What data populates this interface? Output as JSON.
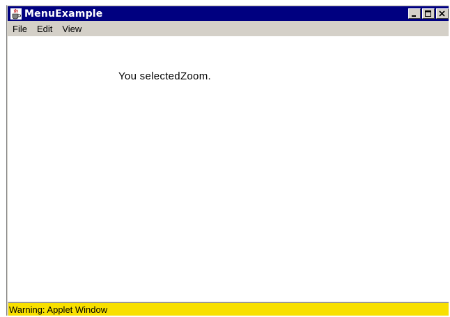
{
  "window": {
    "title": "MenuExample",
    "icon": "java-cup-icon"
  },
  "title_buttons": {
    "minimize_icon": "minimize-icon",
    "maximize_icon": "maximize-icon",
    "close_icon": "close-icon"
  },
  "menu": {
    "items": [
      {
        "label": "File"
      },
      {
        "label": "Edit"
      },
      {
        "label": "View"
      }
    ]
  },
  "content": {
    "message": "You selectedZoom."
  },
  "status": {
    "text": "Warning: Applet Window"
  },
  "colors": {
    "title_bar": "#000080",
    "window_face": "#d4d0c8",
    "status_bar": "#f8e000",
    "content_bg": "#ffffff"
  }
}
